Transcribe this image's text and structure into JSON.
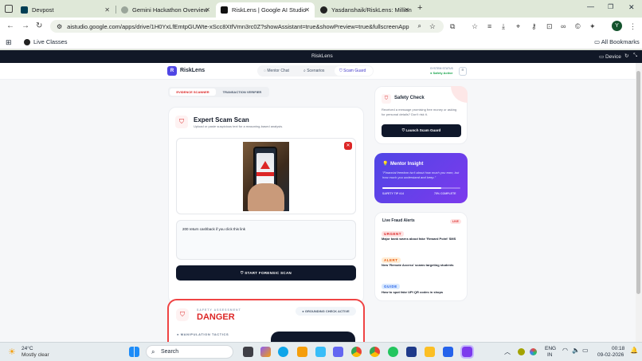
{
  "tabs": [
    {
      "title": "Devpost",
      "active": false
    },
    {
      "title": "Gemini Hackathon Overview",
      "active": false
    },
    {
      "title": "RiskLens | Google AI Studio",
      "active": true
    },
    {
      "title": "Yasdanshaik/RiskLens: Million",
      "active": false
    }
  ],
  "browser": {
    "url": "aistudio.google.com/apps/drive/1H0YxLfEmtpGUWte-xScc8XtfVmn3rc0Z?showAssistant=true&showPreview=true&fullscreenApplet...",
    "bookmark": "Live Classes",
    "all_bookmarks": "All Bookmarks",
    "profile": "Y"
  },
  "studio": {
    "app_name": "RiskLens",
    "device": "Device"
  },
  "app": {
    "logo_letter": "R",
    "name": "RiskLens",
    "nav": [
      "Mentor Chat",
      "Scenarios",
      "Scam Guard"
    ],
    "status": {
      "label": "SYSTEM STATUS",
      "value": "Safety Active"
    },
    "subtabs": [
      "EVIDENCE SCANNER",
      "TRANSACTION VERIFIER"
    ],
    "scan": {
      "title": "Expert Scam Scan",
      "subtitle": "Upload or paste suspicious text for a reasoning-based analysis.",
      "text": "200 return cashback if you click this link",
      "button": "START FORENSIC SCAN"
    },
    "result": {
      "label": "SAFETY ASSESSMENT",
      "verdict": "DANGER",
      "badge": "GROUNDING CHECK ACTIVE",
      "tactics": "MANIPULATION TACTICS"
    },
    "safety": {
      "title": "Safety Check",
      "desc": "Received a message promising free money or asking for personal details? Don't risk it.",
      "button": "Launch Scam Guard"
    },
    "mentor": {
      "title": "Mentor Insight",
      "quote": "\"Financial freedom isn't about how much you earn, but how much you understand and keep.\"",
      "tip": "SAFETY TIP #14",
      "progress_label": "75% COMPLETE",
      "progress": 0.75
    },
    "alerts": {
      "title": "Live Fraud Alerts",
      "badge": "LIVE",
      "items": [
        {
          "tag": "URGENT",
          "text": "Major bank warns about fake 'Reward Point' SMS"
        },
        {
          "tag": "ALERT",
          "text": "New 'Remote Access' scams targeting students"
        },
        {
          "tag": "GUIDE",
          "text": "How to spot fake UPI QR codes in shops"
        }
      ]
    }
  },
  "taskbar": {
    "temp": "24°C",
    "weather": "Mostly clear",
    "search": "Search",
    "lang1": "ENG",
    "lang2": "IN",
    "time": "00:18",
    "date": "09-02-2026"
  },
  "colors": {
    "danger": "#dc2626",
    "navy": "#0f172a",
    "purple": "#6d28d9"
  }
}
